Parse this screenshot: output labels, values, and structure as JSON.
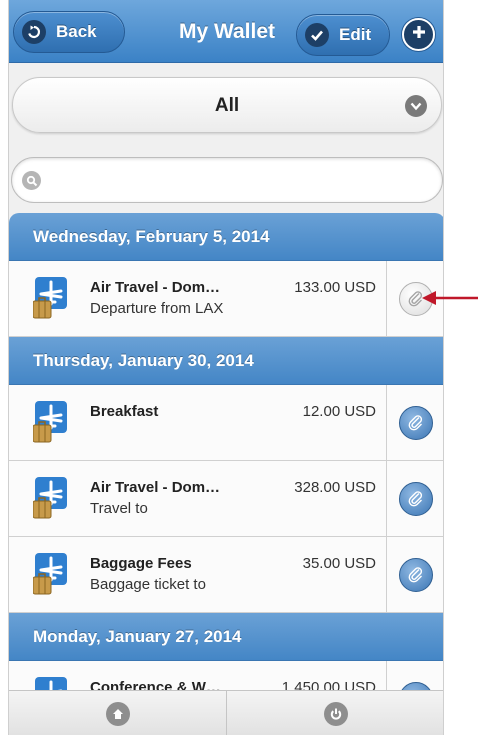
{
  "header": {
    "title": "My Wallet",
    "back_label": "Back",
    "edit_label": "Edit"
  },
  "filter": {
    "value": "All"
  },
  "search": {
    "placeholder": "",
    "value": ""
  },
  "groups": [
    {
      "date": "Wednesday, February 5, 2014",
      "items": [
        {
          "name": "Air Travel - Dom…",
          "sub": "Departure from LAX",
          "amount": "133.00 USD",
          "attachment": "none"
        }
      ]
    },
    {
      "date": "Thursday, January 30, 2014",
      "items": [
        {
          "name": "Breakfast",
          "sub": "",
          "amount": "12.00 USD",
          "attachment": "attached"
        },
        {
          "name": "Air Travel - Dom…",
          "sub": "Travel to",
          "amount": "328.00 USD",
          "attachment": "attached"
        },
        {
          "name": "Baggage Fees",
          "sub": "Baggage ticket to",
          "amount": "35.00 USD",
          "attachment": "attached"
        }
      ]
    },
    {
      "date": "Monday, January 27, 2014",
      "items": [
        {
          "name": "Conference & W…",
          "sub": "",
          "amount": "1,450.00 USD",
          "attachment": "attached"
        }
      ]
    }
  ],
  "icons": {
    "category": "airplane-luggage-icon",
    "attachment": "paperclip-icon",
    "home": "home-icon",
    "power": "power-icon"
  },
  "colors": {
    "header_blue": "#3b82c6",
    "section_blue": "#4486c6",
    "annotation_red": "#c0182a"
  }
}
